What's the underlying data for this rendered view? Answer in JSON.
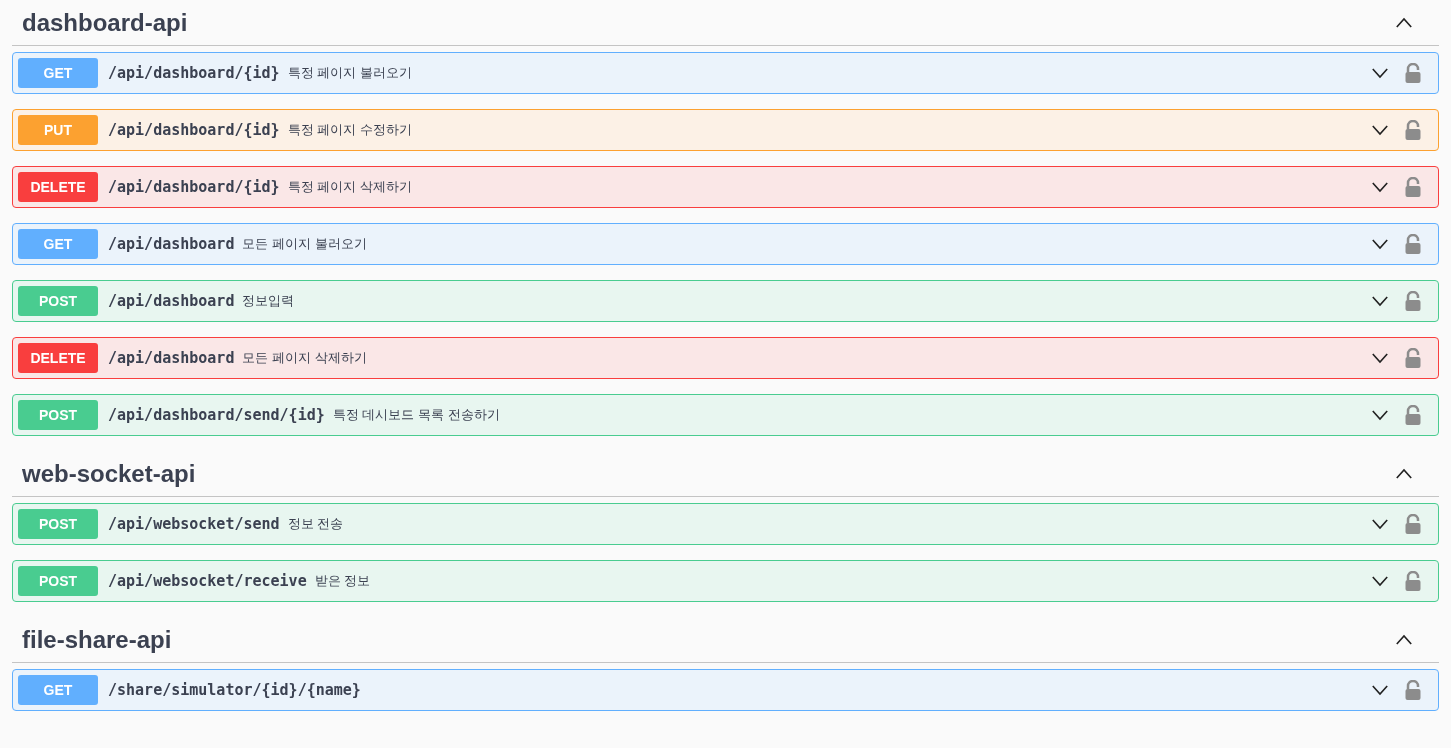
{
  "sections": [
    {
      "title": "dashboard-api",
      "expanded": true,
      "operations": [
        {
          "kind": "get",
          "method": "GET",
          "path": "/api/dashboard/{id}",
          "summary": "특정 페이지 불러오기",
          "expanded": false,
          "locked": false
        },
        {
          "kind": "put",
          "method": "PUT",
          "path": "/api/dashboard/{id}",
          "summary": "특정 페이지 수정하기",
          "expanded": false,
          "locked": false
        },
        {
          "kind": "delete",
          "method": "DELETE",
          "path": "/api/dashboard/{id}",
          "summary": "특정 페이지 삭제하기",
          "expanded": false,
          "locked": false
        },
        {
          "kind": "get",
          "method": "GET",
          "path": "/api/dashboard",
          "summary": "모든 페이지 불러오기",
          "expanded": false,
          "locked": false
        },
        {
          "kind": "post",
          "method": "POST",
          "path": "/api/dashboard",
          "summary": "정보입력",
          "expanded": false,
          "locked": false
        },
        {
          "kind": "delete",
          "method": "DELETE",
          "path": "/api/dashboard",
          "summary": "모든 페이지 삭제하기",
          "expanded": false,
          "locked": false
        },
        {
          "kind": "post",
          "method": "POST",
          "path": "/api/dashboard/send/{id}",
          "summary": "특정 데시보드 목록 전송하기",
          "expanded": false,
          "locked": false
        }
      ]
    },
    {
      "title": "web-socket-api",
      "expanded": true,
      "operations": [
        {
          "kind": "post",
          "method": "POST",
          "path": "/api/websocket/send",
          "summary": "정보 전송",
          "expanded": false,
          "locked": false
        },
        {
          "kind": "post",
          "method": "POST",
          "path": "/api/websocket/receive",
          "summary": "받은 정보",
          "expanded": false,
          "locked": false
        }
      ]
    },
    {
      "title": "file-share-api",
      "expanded": true,
      "operations": [
        {
          "kind": "get",
          "method": "GET",
          "path": "/share/simulator/{id}/{name}",
          "expanded": false,
          "locked": false
        }
      ]
    }
  ]
}
